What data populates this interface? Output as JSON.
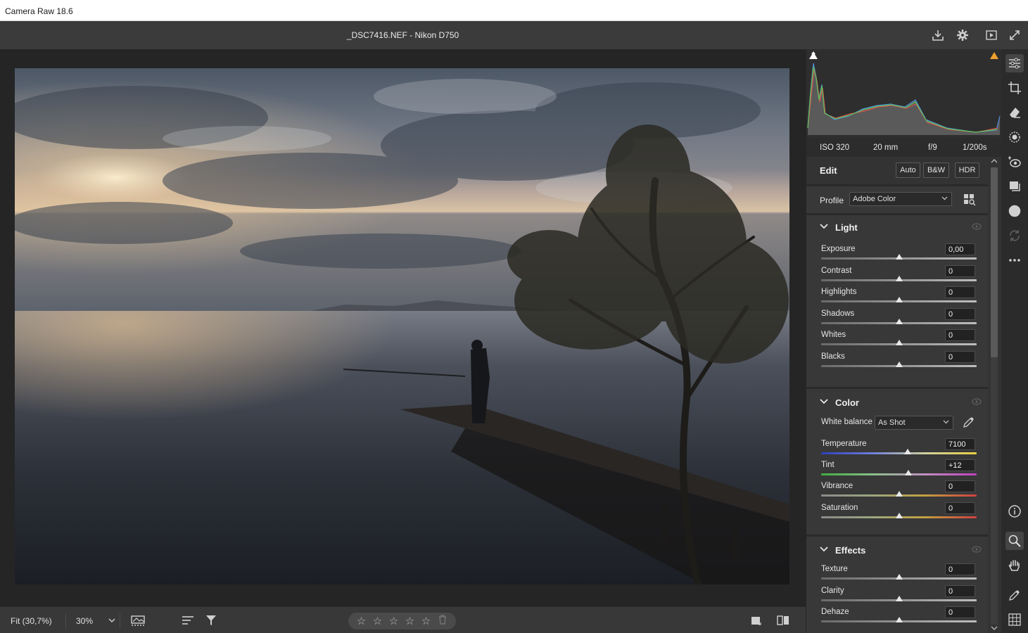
{
  "window": {
    "title": "Camera Raw 18.6"
  },
  "header": {
    "filename": "_DSC7416.NEF  -  Nikon D750"
  },
  "exif": {
    "iso": "ISO 320",
    "focal": "20 mm",
    "aperture": "f/9",
    "shutter": "1/200s"
  },
  "edit": {
    "title": "Edit",
    "auto": "Auto",
    "bw": "B&W",
    "hdr": "HDR"
  },
  "profile": {
    "label": "Profile",
    "value": "Adobe Color"
  },
  "light": {
    "title": "Light",
    "sliders": [
      {
        "name": "Exposure",
        "value": "0,00",
        "pos": 0.5
      },
      {
        "name": "Contrast",
        "value": "0",
        "pos": 0.5
      },
      {
        "name": "Highlights",
        "value": "0",
        "pos": 0.5
      },
      {
        "name": "Shadows",
        "value": "0",
        "pos": 0.5
      },
      {
        "name": "Whites",
        "value": "0",
        "pos": 0.5
      },
      {
        "name": "Blacks",
        "value": "0",
        "pos": 0.5
      }
    ]
  },
  "color": {
    "title": "Color",
    "wb_label": "White balance",
    "wb_value": "As Shot",
    "sliders": [
      {
        "name": "Temperature",
        "value": "7100",
        "pos": 0.555
      },
      {
        "name": "Tint",
        "value": "+12",
        "pos": 0.56
      },
      {
        "name": "Vibrance",
        "value": "0",
        "pos": 0.5
      },
      {
        "name": "Saturation",
        "value": "0",
        "pos": 0.5
      }
    ]
  },
  "effects": {
    "title": "Effects",
    "sliders": [
      {
        "name": "Texture",
        "value": "0",
        "pos": 0.5
      },
      {
        "name": "Clarity",
        "value": "0",
        "pos": 0.5
      },
      {
        "name": "Dehaze",
        "value": "0",
        "pos": 0.5
      }
    ]
  },
  "bottom": {
    "zoom_fit": "Fit (30,7%)",
    "zoom_pct": "30%",
    "rating": 0
  }
}
